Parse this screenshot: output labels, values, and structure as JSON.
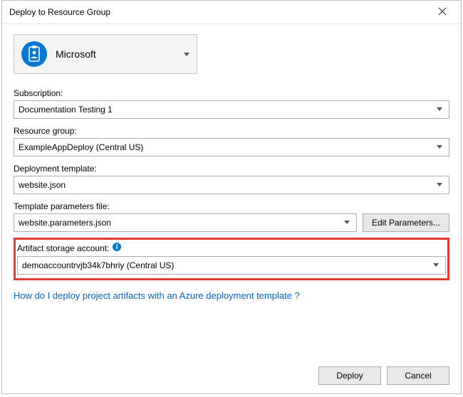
{
  "window": {
    "title": "Deploy to Resource Group"
  },
  "account": {
    "name": "Microsoft"
  },
  "fields": {
    "subscription": {
      "label": "Subscription:",
      "value": "Documentation Testing 1"
    },
    "resourceGroup": {
      "label": "Resource group:",
      "value": "ExampleAppDeploy (Central US)"
    },
    "template": {
      "label": "Deployment template:",
      "value": "website.json"
    },
    "paramsFile": {
      "label": "Template parameters file:",
      "value": "website.parameters.json"
    },
    "artifact": {
      "label": "Artifact storage account:",
      "value": "demoaccountrvjb34k7bhriy (Central US)"
    }
  },
  "buttons": {
    "editParams": "Edit Parameters...",
    "deploy": "Deploy",
    "cancel": "Cancel"
  },
  "link": {
    "text": "How do I deploy project artifacts with an Azure deployment template ?"
  }
}
